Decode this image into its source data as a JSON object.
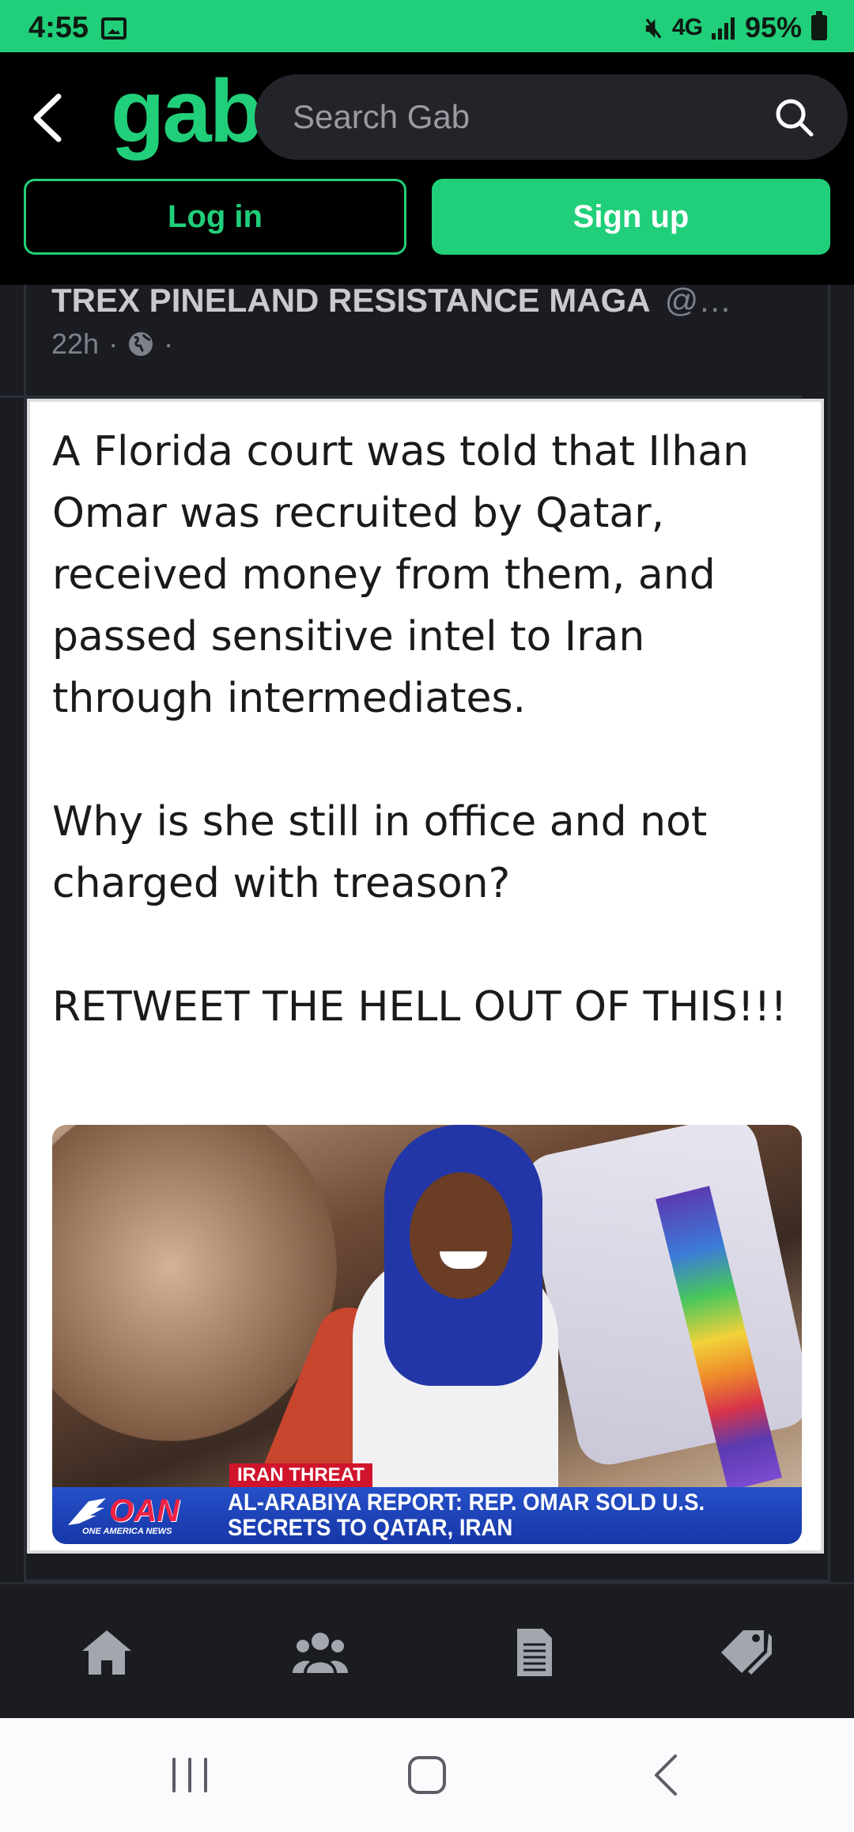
{
  "status_bar": {
    "time": "4:55",
    "network": "4G",
    "battery": "95%"
  },
  "header": {
    "logo": "gab",
    "search_placeholder": "Search Gab",
    "login_label": "Log in",
    "signup_label": "Sign up",
    "accent_color": "#21cf7a"
  },
  "post": {
    "author": "TREX PINELAND RESISTANCE MAGA",
    "handle": "@…",
    "time_ago": "22h",
    "visibility_icon": "globe-icon",
    "meme_text": "A Florida court was told that Ilhan Omar was recruited by Qatar, received money from them, and passed sensitive intel to Iran through intermediates.\n\nWhy is she still in office and not charged with treason?\n\nRETWEET THE HELL OUT OF THIS!!!",
    "image": {
      "tag": "IRAN THREAT",
      "network_logo": "OAN",
      "network_subtitle": "ONE AMERICA NEWS",
      "headline": "AL-ARABIYA REPORT: REP. OMAR SOLD U.S. SECRETS TO QATAR, IRAN"
    }
  },
  "bottom_nav": {
    "items": [
      "home-icon",
      "groups-icon",
      "news-icon",
      "tags-icon"
    ]
  },
  "system_nav": {
    "items": [
      "recents-icon",
      "home-circle-icon",
      "back-icon"
    ]
  }
}
